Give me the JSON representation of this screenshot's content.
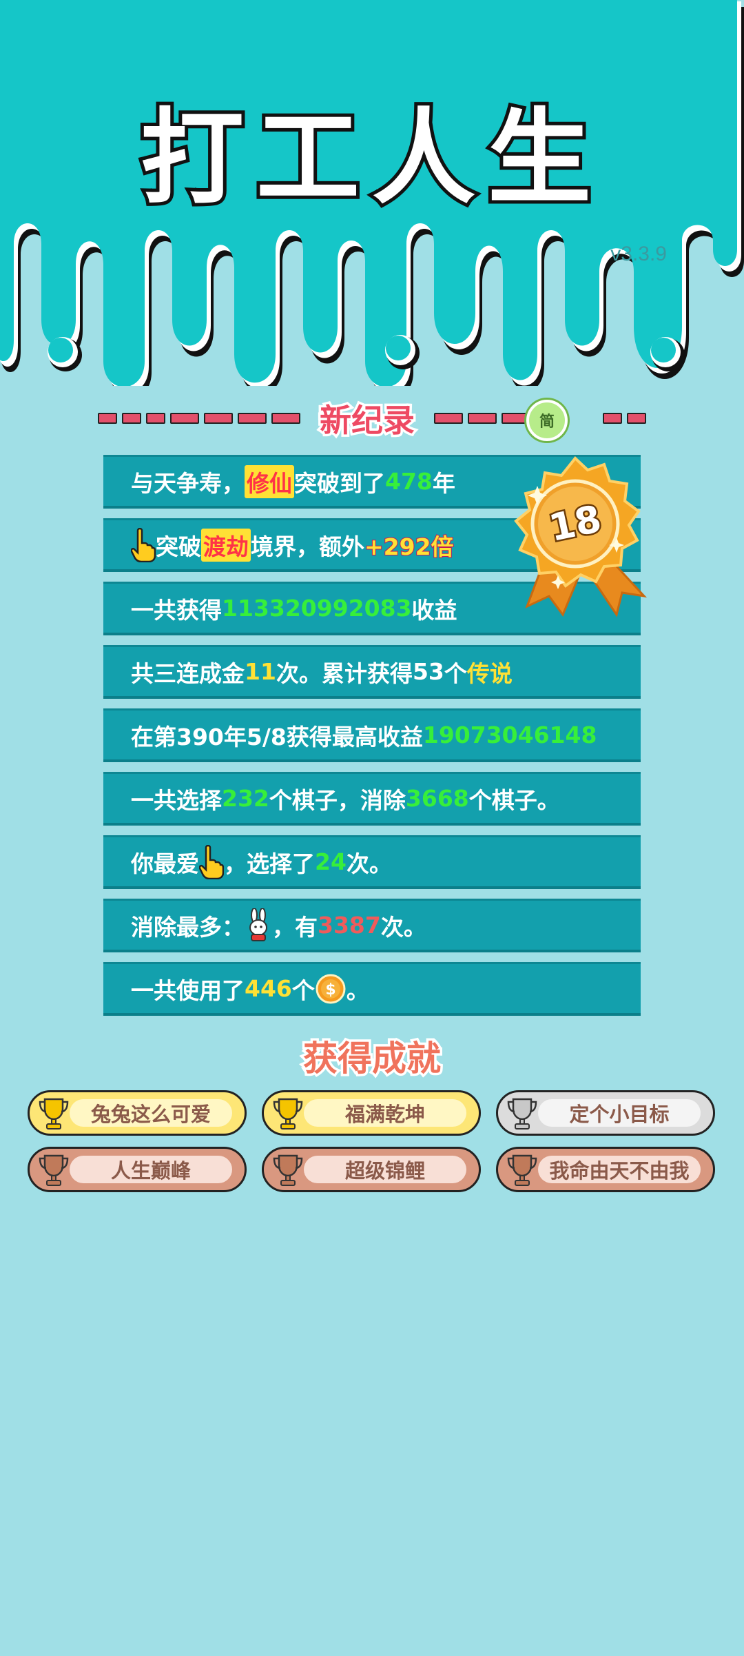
{
  "header": {
    "title": "打工人生",
    "version": "v3.3.9"
  },
  "banner": {
    "title": "新纪录",
    "jian_badge": "简"
  },
  "medal": {
    "level": "18"
  },
  "stats": {
    "row1": {
      "a": "与天争寿，",
      "b": "修仙",
      "c": "突破到了",
      "d": "478",
      "e": "年"
    },
    "row2": {
      "a": "突破",
      "b": "渡劫",
      "c": "境界，额外",
      "d": "+292倍"
    },
    "row3": {
      "a": "一共获得",
      "b": "113320992083",
      "c": "收益"
    },
    "row4": {
      "a": "共",
      "b": "三连成金",
      "c": "11",
      "d": "次。累计获得",
      "e": "53",
      "f": "个",
      "g": "传说"
    },
    "row5": {
      "a": "在 ",
      "b": "第390年5/8",
      "c": " 获得最高收益",
      "d": "19073046148"
    },
    "row6": {
      "a": "一共选择",
      "b": "232",
      "c": "个棋子，消除",
      "d": "3668",
      "e": "个棋子。"
    },
    "row7": {
      "a": "你最爱",
      "b": "，选择了",
      "c": "24",
      "d": "次。"
    },
    "row8": {
      "a": "消除最多：",
      "b": "，有",
      "c": "3387",
      "d": "次。"
    },
    "row9": {
      "a": "一共使用了",
      "b": "446",
      "c": "个",
      "d": "。"
    }
  },
  "achievements": {
    "title": "获得成就",
    "items": [
      {
        "label": "兔兔这么可爱",
        "tier": "gold"
      },
      {
        "label": "福满乾坤",
        "tier": "gold"
      },
      {
        "label": "定个小目标",
        "tier": "silver"
      },
      {
        "label": "人生巅峰",
        "tier": "bronze"
      },
      {
        "label": "超级锦鲤",
        "tier": "bronze"
      },
      {
        "label": "我命由天不由我",
        "tier": "bronze"
      }
    ]
  },
  "colors": {
    "header_bg": "#15c6c8",
    "page_bg": "#a0dfe6",
    "row_bg": "#13a0ad",
    "green": "#37ef3a",
    "yellow": "#ffe135",
    "red": "#f05b5b"
  }
}
